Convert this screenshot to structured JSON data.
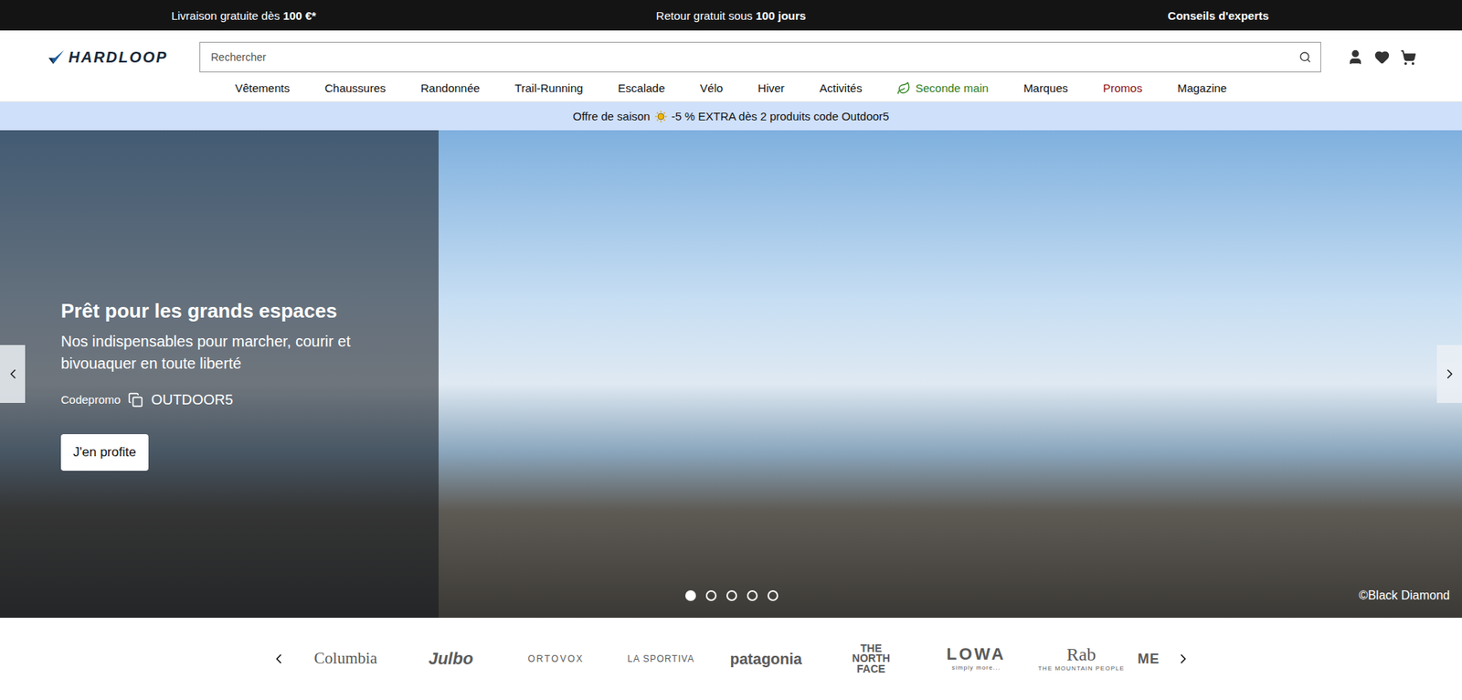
{
  "top_bar": [
    {
      "parts": [
        {
          "text": "Livraison gratuite dès ",
          "bold": false
        },
        {
          "text": "100 €*",
          "bold": true
        }
      ]
    },
    {
      "parts": [
        {
          "text": "Retour gratuit sous ",
          "bold": false
        },
        {
          "text": "100 jours",
          "bold": true
        }
      ]
    },
    {
      "parts": [
        {
          "text": "Conseils d'experts",
          "bold": true
        }
      ]
    }
  ],
  "logo": "HARDLOOP",
  "search": {
    "placeholder": "Rechercher"
  },
  "nav": [
    {
      "label": "Vêtements",
      "kind": "normal"
    },
    {
      "label": "Chaussures",
      "kind": "normal"
    },
    {
      "label": "Randonnée",
      "kind": "normal"
    },
    {
      "label": "Trail-Running",
      "kind": "normal"
    },
    {
      "label": "Escalade",
      "kind": "normal"
    },
    {
      "label": "Vélo",
      "kind": "normal"
    },
    {
      "label": "Hiver",
      "kind": "normal"
    },
    {
      "label": "Activités",
      "kind": "normal"
    },
    {
      "label": "Seconde main",
      "kind": "eco"
    },
    {
      "label": "Marques",
      "kind": "normal"
    },
    {
      "label": "Promos",
      "kind": "promo"
    },
    {
      "label": "Magazine",
      "kind": "normal"
    }
  ],
  "promo_bar": {
    "before": "Offre de saison",
    "after": "-5 % EXTRA dès 2 produits code Outdoor5"
  },
  "hero": {
    "title": "Prêt pour les grands espaces",
    "subtitle": "Nos indispensables pour marcher, courir et bivouaquer en toute liberté",
    "code_label": "Codepromo",
    "code": "OUTDOOR5",
    "button": "J'en profite",
    "credit": "©Black Diamond",
    "slides": [
      {
        "selected": true
      },
      {
        "selected": false
      },
      {
        "selected": false
      },
      {
        "selected": false
      },
      {
        "selected": false
      }
    ]
  },
  "brands": [
    {
      "name": "Columbia",
      "kind": "columbia"
    },
    {
      "name": "Julbo",
      "kind": "julbo"
    },
    {
      "name": "ORTOVOX",
      "kind": "ortovox"
    },
    {
      "name": "LA SPORTIVA",
      "kind": "sportiva"
    },
    {
      "name": "patagonia",
      "kind": "patagonia"
    },
    {
      "name": "THE NORTH FACE",
      "kind": "northface"
    },
    {
      "name": "LOWA",
      "tagline": "simply more...",
      "kind": "lowa"
    },
    {
      "name": "Rab",
      "tagline": "THE MOUNTAIN PEOPLE",
      "kind": "rab"
    },
    {
      "name": "ME",
      "kind": "cut"
    }
  ]
}
